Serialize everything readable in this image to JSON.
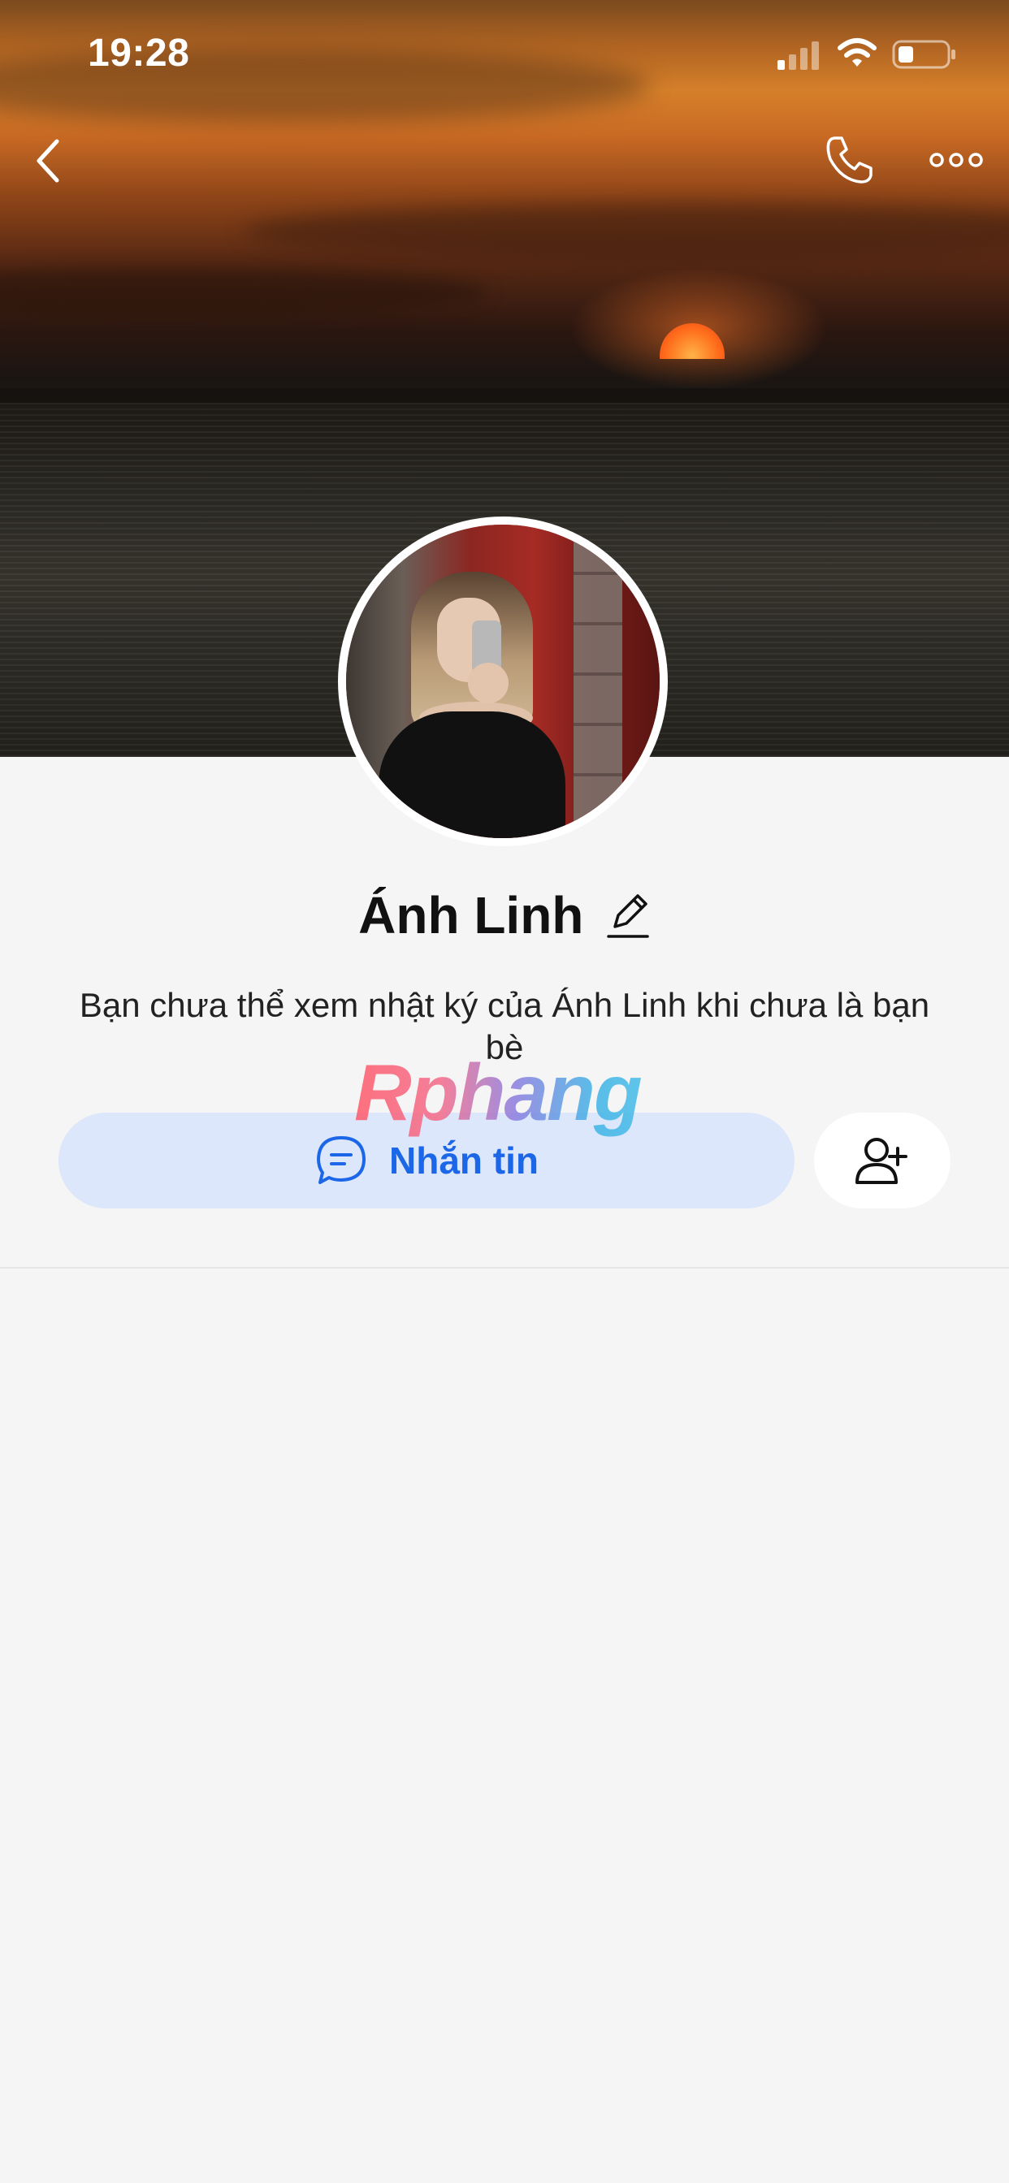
{
  "status_bar": {
    "time": "19:28",
    "icons": [
      "signal-icon",
      "wifi-icon",
      "battery-icon"
    ]
  },
  "nav": {
    "icons": [
      "back-icon",
      "phone-icon",
      "more-icon"
    ]
  },
  "profile": {
    "name": "Ánh Linh",
    "privacy_notice": "Bạn chưa thể xem nhật ký của Ánh Linh khi chưa là bạn bè"
  },
  "actions": {
    "message_label": "Nhắn tin",
    "add_friend_icon": "add-friend-icon"
  },
  "watermark": {
    "text": "Rphang"
  },
  "colors": {
    "accent": "#1c66e8",
    "message_button_bg": "#dce7fb",
    "page_bg": "#f4f5f4"
  }
}
